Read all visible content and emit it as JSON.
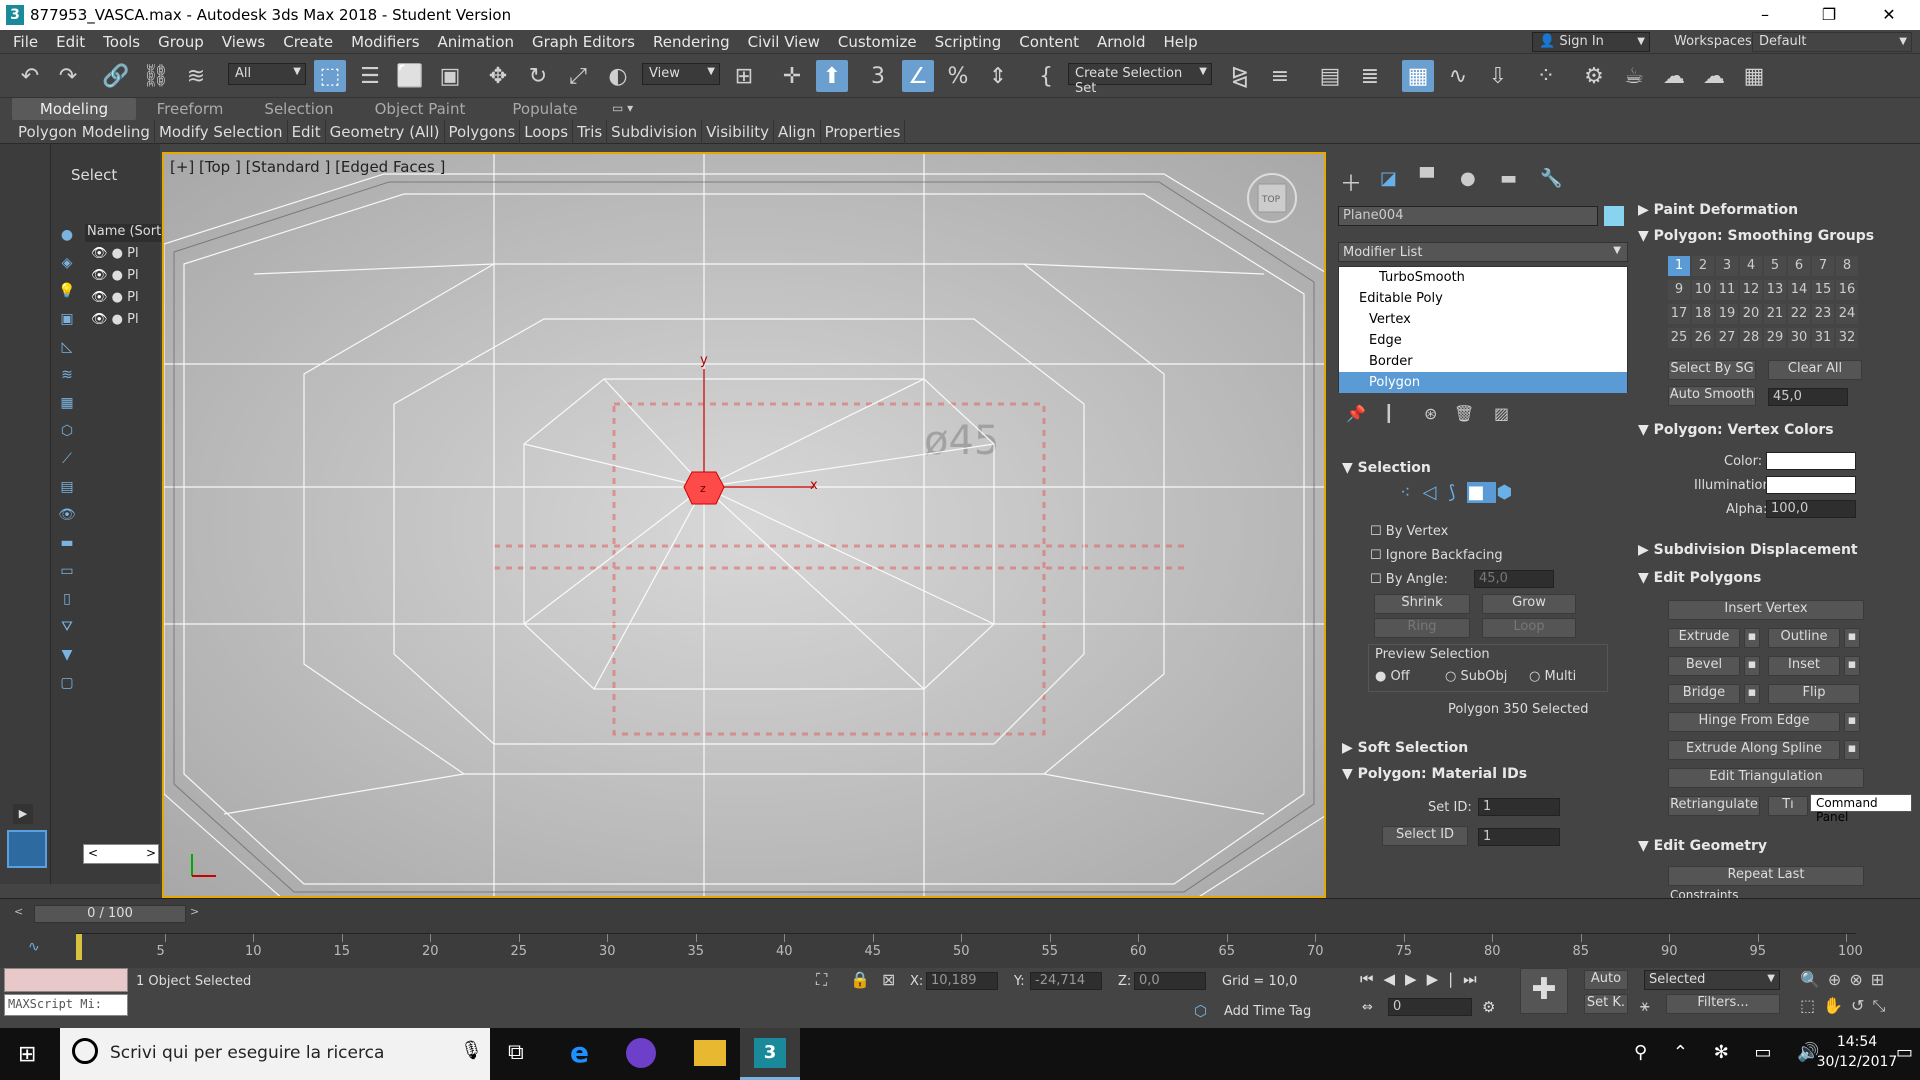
{
  "titlebar": {
    "title": "877953_VASCA.max - Autodesk 3ds Max 2018 - Student Version",
    "app_icon": "3",
    "minimize": "–",
    "maximize": "❐",
    "close": "✕"
  },
  "menu": [
    "File",
    "Edit",
    "Tools",
    "Group",
    "Views",
    "Create",
    "Modifiers",
    "Animation",
    "Graph Editors",
    "Rendering",
    "Civil View",
    "Customize",
    "Scripting",
    "Content",
    "Arnold",
    "Help"
  ],
  "account": {
    "sign_in": "Sign In",
    "workspaces_label": "Workspaces:",
    "workspace": "Default"
  },
  "toolbar": {
    "filter": "All",
    "view": "View",
    "selection_set": "Create Selection Set",
    "snap_label": "3"
  },
  "ribbon": {
    "tabs": [
      "Modeling",
      "Freeform",
      "Selection",
      "Object Paint",
      "Populate"
    ],
    "subtabs": [
      "Polygon Modeling",
      "Modify Selection",
      "Edit",
      "Geometry (All)",
      "Polygons",
      "Loops",
      "Tris",
      "Subdivision",
      "Visibility",
      "Align",
      "Properties"
    ]
  },
  "scene": {
    "select_label": "Select",
    "column": "Name (Sorte",
    "rows": [
      "Pl",
      "Pl",
      "Pl",
      "Pl"
    ],
    "nav_left": "<",
    "nav_right": ">"
  },
  "viewport": {
    "label": "[+] [Top ] [Standard ] [Edged Faces ]",
    "axis_x": "x",
    "axis_y": "y",
    "axis_z": "z",
    "ghost_text": "ø45",
    "viewcube": "TOP"
  },
  "command_panel": {
    "object_name": "Plane004",
    "object_color": "#87d3f0",
    "modifier_list": "Modifier List",
    "stack": [
      "TurboSmooth",
      "Editable Poly",
      "Vertex",
      "Edge",
      "Border",
      "Polygon"
    ],
    "selection": {
      "title": "Selection",
      "by_vertex": "By Vertex",
      "ignore_backfacing": "Ignore Backfacing",
      "by_angle": "By Angle:",
      "angle": "45,0",
      "shrink": "Shrink",
      "grow": "Grow",
      "ring": "Ring",
      "loop": "Loop",
      "preview": "Preview Selection",
      "off": "Off",
      "subobj": "SubObj",
      "multi": "Multi",
      "status": "Polygon 350 Selected"
    },
    "soft_selection": "Soft Selection",
    "material_ids": {
      "title": "Polygon: Material IDs",
      "set_id": "Set ID:",
      "set_val": "1",
      "select_id": "Select ID",
      "select_val": "1"
    },
    "paint_deformation": "Paint Deformation",
    "smoothing": {
      "title": "Polygon: Smoothing Groups",
      "groups": [
        "1",
        "2",
        "3",
        "4",
        "5",
        "6",
        "7",
        "8",
        "9",
        "10",
        "11",
        "12",
        "13",
        "14",
        "15",
        "16",
        "17",
        "18",
        "19",
        "20",
        "21",
        "22",
        "23",
        "24",
        "25",
        "26",
        "27",
        "28",
        "29",
        "30",
        "31",
        "32"
      ],
      "select_by_sg": "Select By SG",
      "clear_all": "Clear All",
      "auto_smooth": "Auto Smooth",
      "auto_val": "45,0"
    },
    "vertex_colors": {
      "title": "Polygon: Vertex Colors",
      "color": "Color:",
      "illumination": "Illumination:",
      "alpha": "Alpha:",
      "alpha_val": "100,0"
    },
    "subdivision_displacement": "Subdivision Displacement",
    "edit_polygons": {
      "title": "Edit Polygons",
      "insert_vertex": "Insert Vertex",
      "extrude": "Extrude",
      "outline": "Outline",
      "bevel": "Bevel",
      "inset": "Inset",
      "bridge": "Bridge",
      "flip": "Flip",
      "hinge": "Hinge From Edge",
      "extrude_spline": "Extrude Along Spline",
      "edit_tri": "Edit Triangulation",
      "retriangulate": "Retriangulate",
      "turn": "Tı"
    },
    "tooltip": "Command Panel",
    "edit_geometry": {
      "title": "Edit Geometry",
      "repeat_last": "Repeat Last",
      "constraints": "Constraints"
    }
  },
  "timeline": {
    "frame": "0 / 100",
    "ticks": [
      "5",
      "10",
      "15",
      "20",
      "25",
      "30",
      "35",
      "40",
      "45",
      "50",
      "55",
      "60",
      "65",
      "70",
      "75",
      "80",
      "85",
      "90",
      "95",
      "100"
    ]
  },
  "status": {
    "maxscript": "MAXScript Mi:",
    "selected": "1 Object Selected",
    "x_label": "X:",
    "x": "10,189",
    "y_label": "Y:",
    "y": "-24,714",
    "z_label": "Z:",
    "z": "0,0",
    "grid": "Grid = 10,0",
    "add_time_tag": "Add Time Tag",
    "auto": "Auto",
    "set_key": "Set K.",
    "selected_dd": "Selected",
    "filters": "Filters...",
    "frame_val": "0"
  },
  "taskbar": {
    "search": "Scrivi qui per eseguire la ricerca",
    "time": "14:54",
    "date": "30/12/2017"
  }
}
